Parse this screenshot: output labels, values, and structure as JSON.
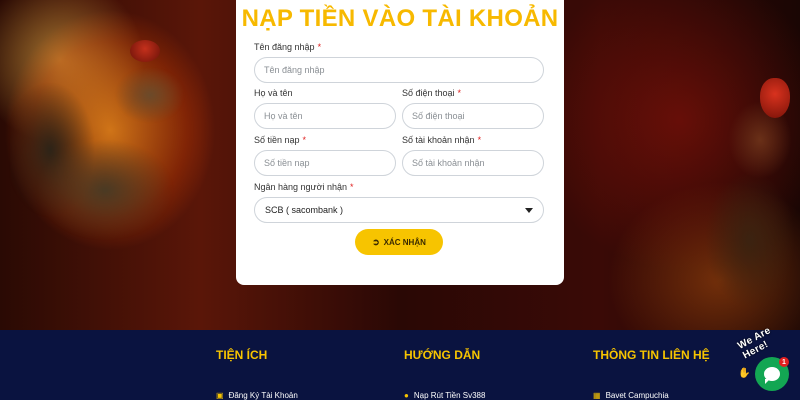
{
  "form": {
    "title": "NẠP TIỀN VÀO TÀI KHOẢN",
    "fields": {
      "username": {
        "label": "Tên đăng nhập",
        "placeholder": "Tên đăng nhập",
        "required_mark": "*"
      },
      "fullname": {
        "label": "Họ và tên",
        "placeholder": "Họ và tên"
      },
      "phone": {
        "label": "Số điện thoại",
        "placeholder": "Số điện thoại",
        "required_mark": "*"
      },
      "amount": {
        "label": "Số tiền nạp",
        "placeholder": "Số tiền nạp",
        "required_mark": "*"
      },
      "receiver_account": {
        "label": "Số tài khoản nhận",
        "placeholder": "Số tài khoản nhận",
        "required_mark": "*"
      },
      "receiver_bank": {
        "label": "Ngân hàng người nhận",
        "value": "SCB ( sacombank )",
        "required_mark": "*"
      }
    },
    "submit_label": "XÁC NHẬN",
    "submit_icon": "sign-in-icon"
  },
  "footer": {
    "columns": [
      {
        "heading": "TIỆN ÍCH",
        "item": "Đăng Ký Tài Khoản",
        "icon": "square-icon"
      },
      {
        "heading": "HƯỚNG DẪN",
        "item": "Nạp Rút Tiền Sv388",
        "icon": "coins-icon"
      },
      {
        "heading": "THÔNG TIN LIÊN HỆ",
        "item": "Bavet Campuchia",
        "icon": "map-icon"
      }
    ]
  },
  "chat": {
    "label": "We Are Here!",
    "badge_count": "1",
    "color": "#13a653"
  },
  "colors": {
    "accent": "#f7c400",
    "title": "#f7b900",
    "footer_bg": "#0a1340",
    "required": "#e02020"
  }
}
